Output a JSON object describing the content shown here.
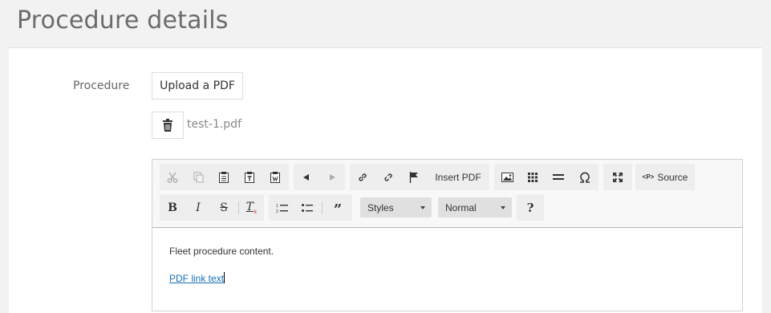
{
  "page": {
    "title": "Procedure details"
  },
  "form": {
    "label": "Procedure",
    "upload_label": "Upload a PDF",
    "file_name": "test-1.pdf"
  },
  "toolbar": {
    "insert_pdf": "Insert PDF",
    "source": "Source",
    "source_glyph": "<P>",
    "styles": "Styles",
    "format": "Normal",
    "help": "?"
  },
  "editor": {
    "paragraph": "Fleet procedure content.",
    "link_text": "PDF link text"
  },
  "icons": [
    "cut-icon",
    "copy-icon",
    "paste-icon",
    "paste-text-icon",
    "paste-word-icon",
    "undo-icon",
    "redo-icon",
    "link-icon",
    "unlink-icon",
    "anchor-icon",
    "image-icon",
    "table-icon",
    "horizontal-line-icon",
    "special-char-icon",
    "maximize-icon",
    "bold-icon",
    "italic-icon",
    "strike-icon",
    "remove-format-icon",
    "numbered-list-icon",
    "bulleted-list-icon",
    "blockquote-icon",
    "trash-icon"
  ]
}
